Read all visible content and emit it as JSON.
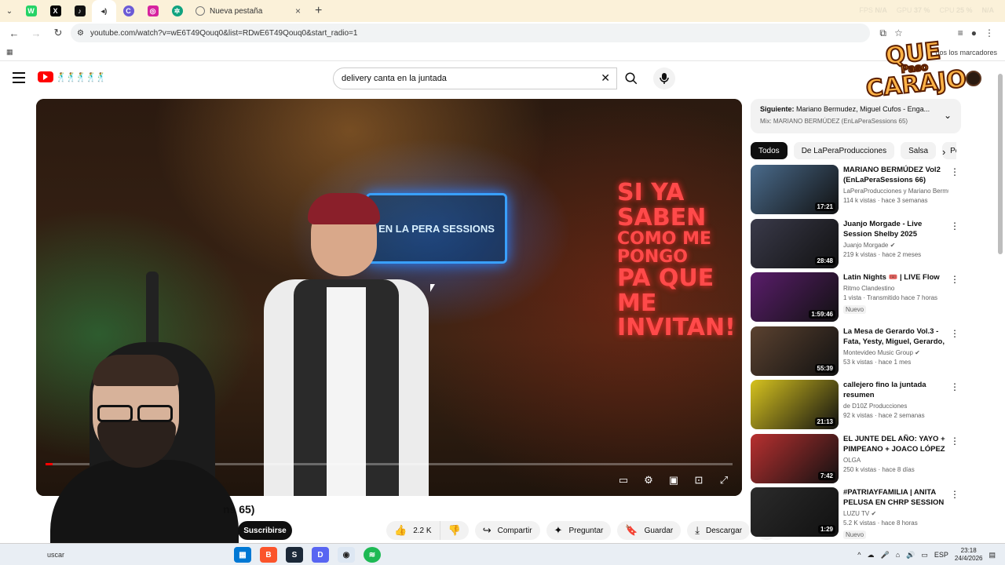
{
  "browser": {
    "tabs": [
      {
        "title": "Nueva pestaña"
      }
    ],
    "new_tab_symbol": "+",
    "perf": {
      "fps_label": "FPS",
      "fps_value": "N/A",
      "gpu_label": "GPU",
      "gpu_value": "37 %",
      "cpu_label": "CPU",
      "cpu_value": "25 %",
      "extra_value": "N/A"
    },
    "url": "youtube.com/watch?v=wE6T49Qouq0&list=RDwE6T49Qouq0&start_radio=1",
    "bookmarks_all": "dos los marcadores"
  },
  "youtube": {
    "search_query": "delivery canta en la juntada",
    "video_title_fragment": "ns 65)",
    "subscribe_label": "Suscribirse",
    "actions": {
      "likes": "2.2 K",
      "share": "Compartir",
      "ask": "Preguntar",
      "save": "Guardar",
      "download": "Descargar"
    },
    "progress_fraction": 0.01,
    "video_overlay": {
      "screen_text": "EN LA PERA SESSIONS",
      "neon_lines": [
        "SI YA SABEN",
        "COMO ME PONGO",
        "PA QUE ME",
        "INVITAN!"
      ]
    }
  },
  "overlay_logo": {
    "line1": "QUE",
    "line2": "Paso",
    "line3": "CARAJO"
  },
  "up_next": {
    "label": "Siguiente:",
    "title": "Mariano Bermudez, Miguel Cufos - Enga...",
    "mix": "Mix: MARIANO BERMÚDEZ (EnLaPeraSessions 65)"
  },
  "chips": [
    "Todos",
    "De LaPeraProducciones",
    "Salsa",
    "Po"
  ],
  "videos": [
    {
      "title": "MARIANO BERMÚDEZ Vol2 (EnLaPeraSessions 66)",
      "channel": "LaPeraProducciones y Mariano Bermúde...",
      "views": "114 k vistas · hace 3 semanas",
      "duration": "17:21",
      "badge": "",
      "color": "#4a6b8c"
    },
    {
      "title": "Juanjo Morgade - Live Session Shelby 2025",
      "channel": "Juanjo Morgade",
      "views": "219 k vistas · hace 2 meses",
      "duration": "28:48",
      "badge": "",
      "color": "#3a3a4a"
    },
    {
      "title": "Latin Nights 🎟️ | LIVE Flow",
      "channel": "Ritmo Clandestino",
      "views": "1 vista · Transmitido hace 7 horas",
      "duration": "1:59:46",
      "badge": "Nuevo",
      "color": "#5a1d6b"
    },
    {
      "title": "La Mesa de Gerardo Vol.3 - Fata, Yesty, Miguel, Gerardo, ...",
      "channel": "Montevideo Music Group",
      "views": "53 k vistas · hace 1 mes",
      "duration": "55:39",
      "badge": "",
      "color": "#5b4230"
    },
    {
      "title": "callejero fino la juntada resumen",
      "channel": "de D10Z Producciones",
      "views": "92 k vistas · hace 2 semanas",
      "duration": "21:13",
      "badge": "",
      "color": "#d6c21f"
    },
    {
      "title": "EL JUNTE DEL AÑO: YAYO + PIMPEANO + JOACO LÓPEZ | ...",
      "channel": "OLGA",
      "views": "250 k vistas · hace 8 días",
      "duration": "7:42",
      "badge": "",
      "color": "#b83030"
    },
    {
      "title": "#PATRIAYFAMILIA | ANITA PELUSA EN CHRP SESSION",
      "channel": "LUZU TV",
      "views": "5.2 K vistas · hace 8 horas",
      "duration": "1:29",
      "badge": "Nuevo",
      "color": "#2b2b2b"
    }
  ],
  "taskbar": {
    "search_text": "uscar",
    "lang": "ESP",
    "time": "23:18",
    "date": "24/4/2026"
  }
}
